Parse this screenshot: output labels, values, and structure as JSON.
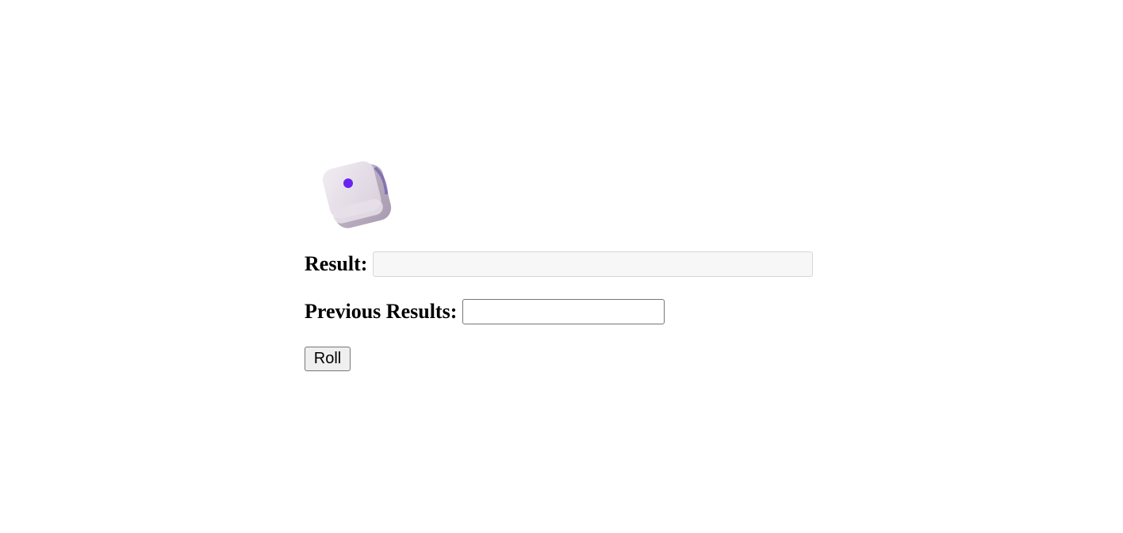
{
  "dice": {
    "icon": "dice-one-icon",
    "face_value": 1,
    "pip_color": "#6a22f0",
    "body_color": "#e6dde8"
  },
  "result": {
    "label": "Result:",
    "value": ""
  },
  "previous": {
    "label": "Previous Results:",
    "value": ""
  },
  "roll_button": {
    "label": "Roll"
  }
}
